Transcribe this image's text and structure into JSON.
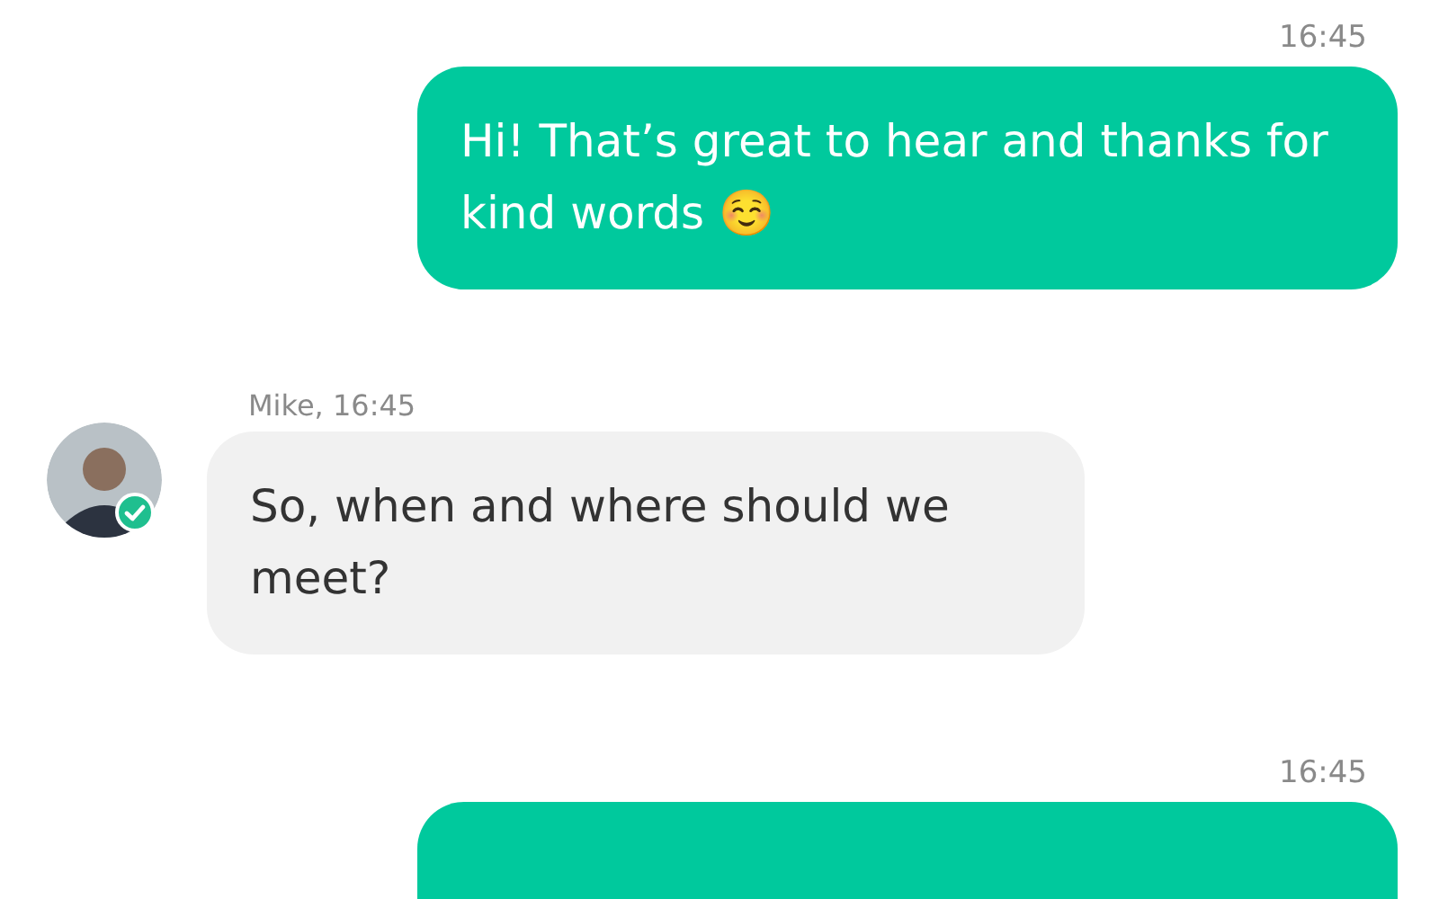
{
  "messages": [
    {
      "kind": "outgoing",
      "time": "16:45",
      "text": "Hi! That’s great to hear and thanks for kind words ☺️"
    },
    {
      "kind": "incoming",
      "sender_time": "Mike, 16:45",
      "verified": true,
      "text": "So, when and where should we meet?"
    },
    {
      "kind": "outgoing",
      "time": "16:45"
    }
  ]
}
